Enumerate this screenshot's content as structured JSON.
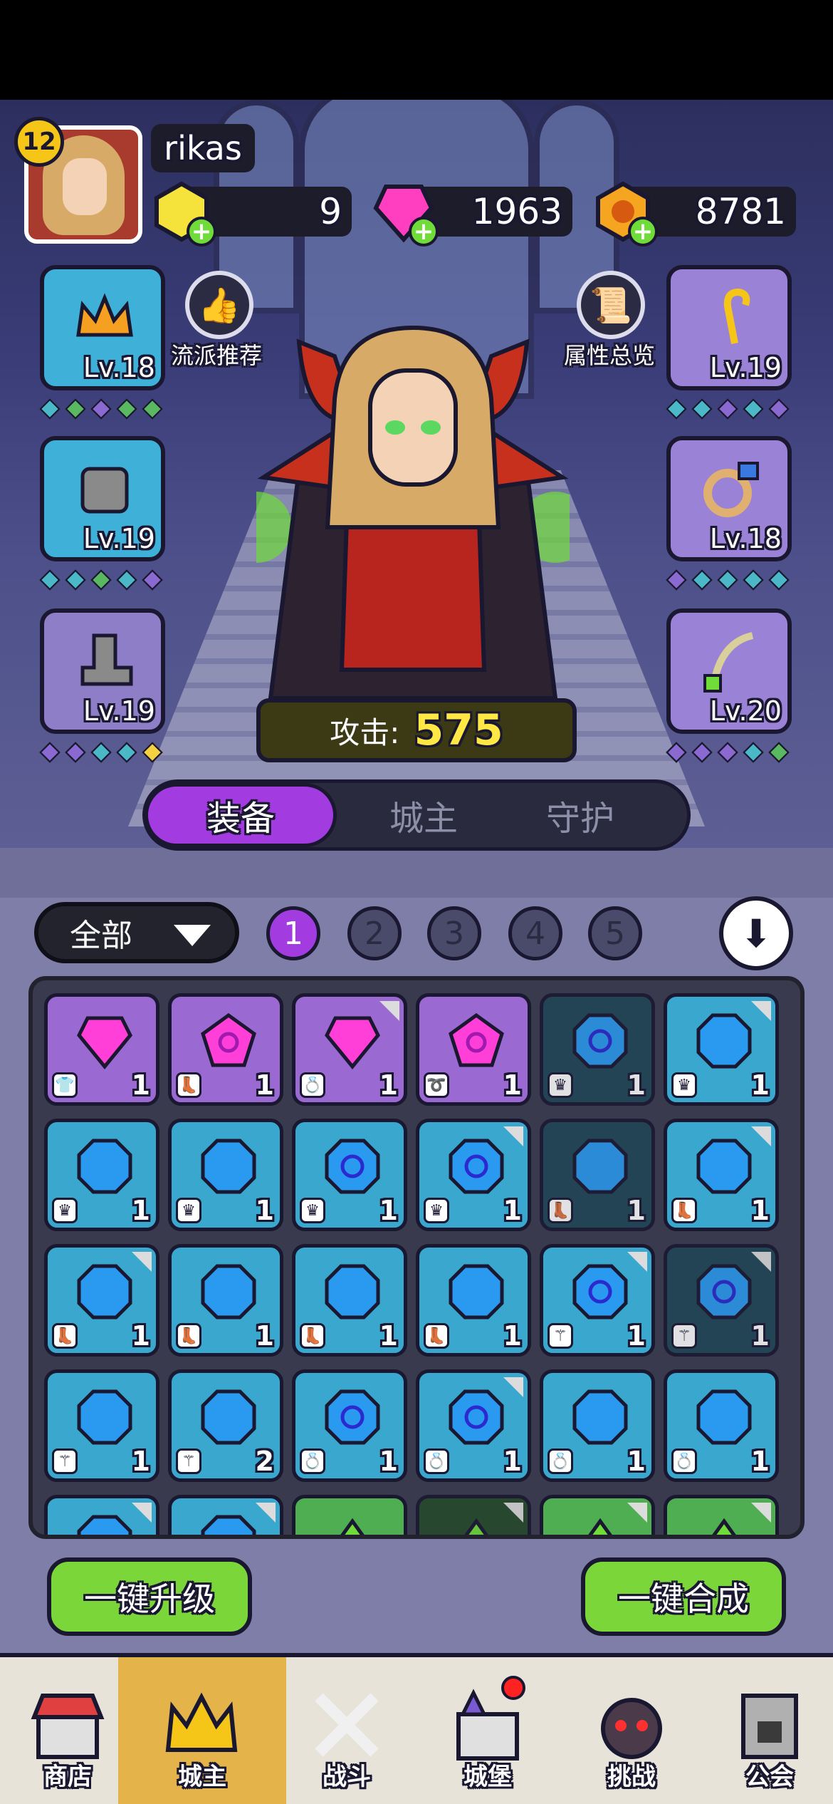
{
  "player": {
    "level": "12",
    "name": "rikas"
  },
  "currencies": [
    {
      "name": "gold-crystal",
      "value": "9",
      "color": "#f5e23a"
    },
    {
      "name": "pink-gem",
      "value": "1963",
      "color": "#ff3fbf"
    },
    {
      "name": "gold-coin",
      "value": "8781",
      "color": "#f5a520"
    }
  ],
  "side_buttons": {
    "left_label": "流派推荐",
    "right_label": "属性总览"
  },
  "slots": {
    "left": [
      {
        "icon": "crown",
        "level": "Lv.18",
        "color": "blue"
      },
      {
        "icon": "armor",
        "level": "Lv.19",
        "color": "blue"
      },
      {
        "icon": "boot",
        "level": "Lv.19",
        "color": "gray"
      }
    ],
    "right": [
      {
        "icon": "staff",
        "level": "Lv.19",
        "color": "purple"
      },
      {
        "icon": "ring",
        "level": "Lv.18",
        "color": "purple"
      },
      {
        "icon": "amulet",
        "level": "Lv.20",
        "color": "purple"
      }
    ]
  },
  "attack": {
    "label": "攻击:",
    "value": "575"
  },
  "tabs": [
    "装备",
    "城主",
    "守护"
  ],
  "filter": {
    "label": "全部"
  },
  "pages": [
    "1",
    "2",
    "3",
    "4",
    "5"
  ],
  "grid": [
    [
      "purple",
      "shirt",
      "1",
      false,
      "pink-gem"
    ],
    [
      "purple",
      "boot",
      "1",
      false,
      "pink-swirl"
    ],
    [
      "purple",
      "ring",
      "1",
      true,
      "pink-gem"
    ],
    [
      "purple",
      "amulet",
      "1",
      false,
      "pink-swirl"
    ],
    [
      "dark",
      "crown",
      "1",
      false,
      "blue-swirl"
    ],
    [
      "blue",
      "crown",
      "1",
      true,
      "blue-gem"
    ],
    [
      "blue",
      "crown",
      "1",
      false,
      "blue-gem"
    ],
    [
      "blue",
      "crown",
      "1",
      false,
      "blue-gem"
    ],
    [
      "blue",
      "crown",
      "1",
      false,
      "blue-swirl"
    ],
    [
      "blue",
      "crown",
      "1",
      true,
      "blue-swirl"
    ],
    [
      "dark",
      "boot",
      "1",
      false,
      "blue-gem"
    ],
    [
      "blue",
      "boot",
      "1",
      true,
      "blue-gem"
    ],
    [
      "blue",
      "boot",
      "1",
      true,
      "blue-gem"
    ],
    [
      "blue",
      "boot",
      "1",
      false,
      "blue-gem"
    ],
    [
      "blue",
      "boot",
      "1",
      false,
      "blue-gem"
    ],
    [
      "blue",
      "boot",
      "1",
      false,
      "blue-gem"
    ],
    [
      "blue",
      "staff",
      "1",
      true,
      "blue-swirl"
    ],
    [
      "dark",
      "staff",
      "1",
      true,
      "blue-swirl"
    ],
    [
      "blue",
      "staff",
      "1",
      false,
      "blue-gem"
    ],
    [
      "blue",
      "staff",
      "2",
      false,
      "blue-gem"
    ],
    [
      "blue",
      "ring",
      "1",
      false,
      "blue-swirl"
    ],
    [
      "blue",
      "ring",
      "1",
      true,
      "blue-swirl"
    ],
    [
      "blue",
      "ring",
      "1",
      false,
      "blue-gem"
    ],
    [
      "blue",
      "ring",
      "1",
      false,
      "blue-gem"
    ],
    [
      "blue",
      "",
      "",
      true,
      "blue-gem"
    ],
    [
      "blue",
      "",
      "",
      true,
      "blue-gem"
    ],
    [
      "green",
      "",
      "",
      false,
      "green-gem"
    ],
    [
      "darkgreen",
      "",
      "",
      true,
      "green-gem"
    ],
    [
      "green",
      "",
      "",
      true,
      "green-gem"
    ],
    [
      "green",
      "",
      "",
      true,
      "green-gem"
    ]
  ],
  "actions": {
    "upgrade_all": "一键升级",
    "merge_all": "一键合成"
  },
  "nav": [
    {
      "label": "商店",
      "icon": "shop-icon"
    },
    {
      "label": "城主",
      "icon": "crown-icon",
      "active": true
    },
    {
      "label": "战斗",
      "icon": "swords-icon"
    },
    {
      "label": "城堡",
      "icon": "castle-icon",
      "badge": true
    },
    {
      "label": "挑战",
      "icon": "demon-icon"
    },
    {
      "label": "公会",
      "icon": "guild-lock-icon"
    }
  ]
}
